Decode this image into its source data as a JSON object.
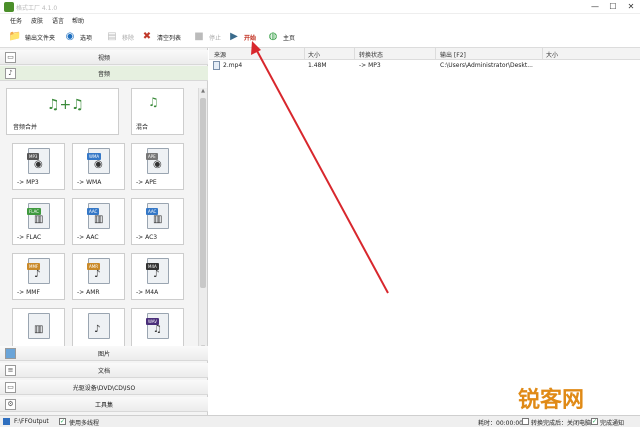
{
  "window": {
    "title": "格式工厂 4.1.0",
    "min": "—",
    "max": "☐",
    "close": "✕"
  },
  "menu": [
    "任务",
    "皮肤",
    "语言",
    "帮助"
  ],
  "toolbar": {
    "output_folder": "输出文件夹",
    "options": "选项",
    "remove": "移除",
    "clear_list": "清空列表",
    "stop": "停止",
    "start": "开始",
    "home": "主页"
  },
  "categories": {
    "video": "视频",
    "audio": "音频",
    "picture": "图片",
    "document": "文档",
    "rom": "光驱设备\\DVD\\CD\\ISO",
    "toolbox": "工具集"
  },
  "audio_tiles": [
    {
      "label": "音频合并",
      "fmt": ""
    },
    {
      "label": "混合",
      "fmt": ""
    },
    {
      "label": "-> MP3",
      "fmt": "MP3"
    },
    {
      "label": "-> WMA",
      "fmt": "WMA"
    },
    {
      "label": "-> APE",
      "fmt": "APE"
    },
    {
      "label": "-> FLAC",
      "fmt": "FLAC"
    },
    {
      "label": "-> AAC",
      "fmt": "AAC"
    },
    {
      "label": "-> AC3",
      "fmt": "AAC"
    },
    {
      "label": "-> MMF",
      "fmt": "MMF"
    },
    {
      "label": "-> AMR",
      "fmt": "AMR"
    },
    {
      "label": "-> M4A",
      "fmt": "M4A"
    },
    {
      "label": "",
      "fmt": ""
    },
    {
      "label": "",
      "fmt": ""
    },
    {
      "label": "",
      "fmt": "WAV"
    }
  ],
  "table": {
    "headers": [
      "来源",
      "大小",
      "转换状态",
      "输出 [F2]",
      "大小"
    ],
    "rows": [
      {
        "source": "2.mp4",
        "size": "1.48M",
        "status": "-> MP3",
        "output": "C:\\Users\\Administrator\\Deskt...",
        "out_size": ""
      }
    ]
  },
  "status": {
    "output_path": "F:\\FFOutput",
    "multithread": "使用多线程",
    "elapsed": "耗时：00:00:00",
    "shutdown": "转换完成后：关闭电脑",
    "notify": "完成通知"
  },
  "watermark": "锐客网",
  "colors": {
    "accent": "#c02b1b",
    "arrow": "#d8272d",
    "watermark": "#e08a16"
  }
}
